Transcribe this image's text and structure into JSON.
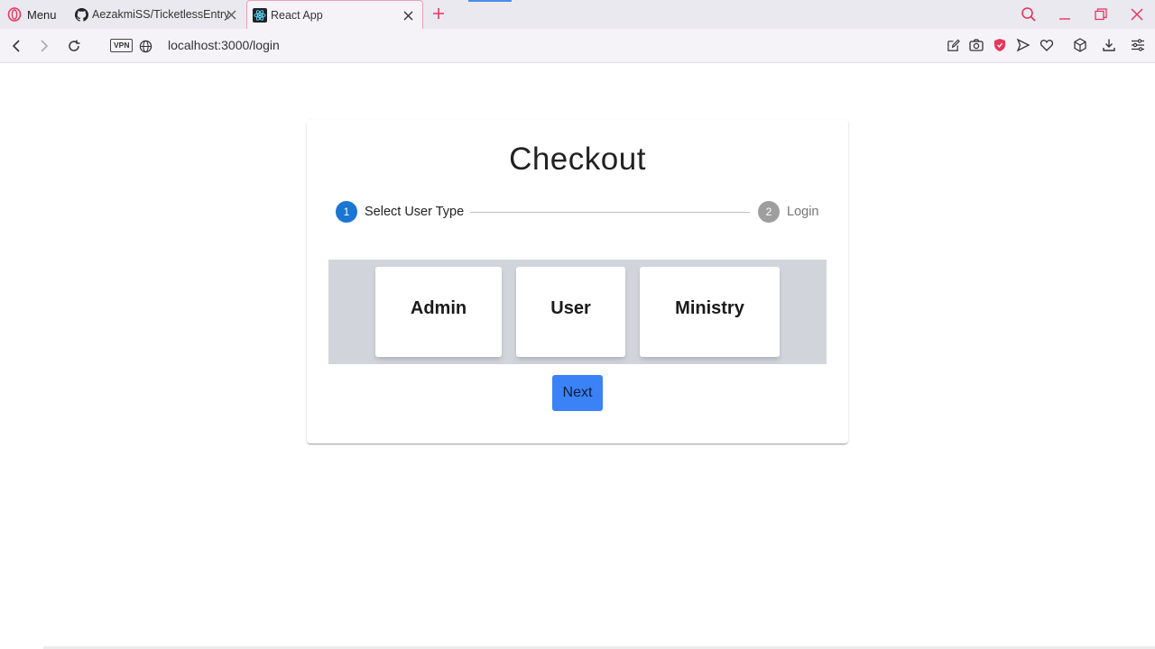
{
  "browser": {
    "menu_label": "Menu",
    "tabs": [
      {
        "title": "AezakmiSS/TicketlessEntry",
        "favicon": "github-icon",
        "active": false
      },
      {
        "title": "React App",
        "favicon": "react-icon",
        "active": true
      }
    ],
    "url": "localhost:3000/login",
    "vpn_label": "VPN",
    "accent_color": "#e8365d"
  },
  "page": {
    "title": "Checkout",
    "steps": [
      {
        "number": "1",
        "label": "Select User Type",
        "active": true
      },
      {
        "number": "2",
        "label": "Login",
        "active": false
      }
    ],
    "user_types": [
      "Admin",
      "User",
      "Ministry"
    ],
    "next_label": "Next",
    "colors": {
      "active_step": "#1976d2",
      "next_button": "#3b82f6",
      "choices_bg": "#d1d5db"
    }
  }
}
